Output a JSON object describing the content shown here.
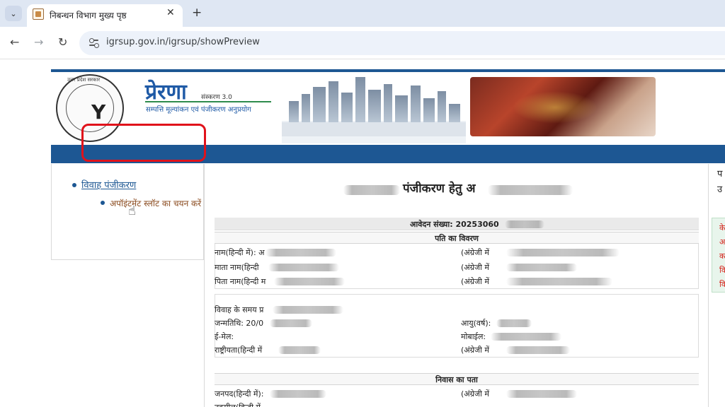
{
  "browser": {
    "tab_title": "निबन्धन विभाग मुख्य पृष्ठ",
    "tab_close": "✕",
    "new_tab": "+",
    "tab_menu": "⌄",
    "url": "igrsup.gov.in/igrsup/showPreview",
    "back": "←",
    "forward": "→",
    "reload": "↻"
  },
  "header": {
    "emblem_text": "उत्तर प्रदेश सरकार",
    "brand": "प्रेरणा",
    "version": "संस्करण 3.0",
    "tagline": "सम्पत्ति मूल्यांकन एवं पंजीकरण अनुप्रयोग"
  },
  "sidebar": {
    "item_main": "विवाह पंजीकरण",
    "item_sub": "अपॉइंटमेंट स्लॉट का चयन करें"
  },
  "form": {
    "title": "पंजीकरण हेतु अ",
    "application_no": "आवेदन संख्या: 20253060",
    "husband_section": "पति का विवरण",
    "name_hindi": "नाम(हिन्दी में): अ",
    "english_1": "(अंग्रेजी में",
    "mother_name": "माता नाम(हिन्दी",
    "english_2": "(अंग्रेजी में",
    "father_name": "पिता नाम(हिन्दी म",
    "english_3": "(अंग्रेजी में",
    "marriage_time": "विवाह के समय प्र",
    "dob": "जन्मतिथि: 20/0",
    "age": "आयु(वर्ष):",
    "email": "ई-मेल:",
    "mobile": "मोबाईल:",
    "nationality": "राष्ट्रीयता(हिन्दी में",
    "english_4": "(अंग्रेजी में",
    "address_section": "निवास का पता",
    "district": "जनपद(हिन्दी में):",
    "english_5": "(अंग्रेजी में",
    "partial_row": "तहसील(हिन्दी में"
  },
  "right_panel": {
    "top_1": "प",
    "top_2": "उ",
    "red_1": "के",
    "red_2": "अ",
    "red_3": "क",
    "red_4": "वि",
    "red_5": "वि"
  }
}
